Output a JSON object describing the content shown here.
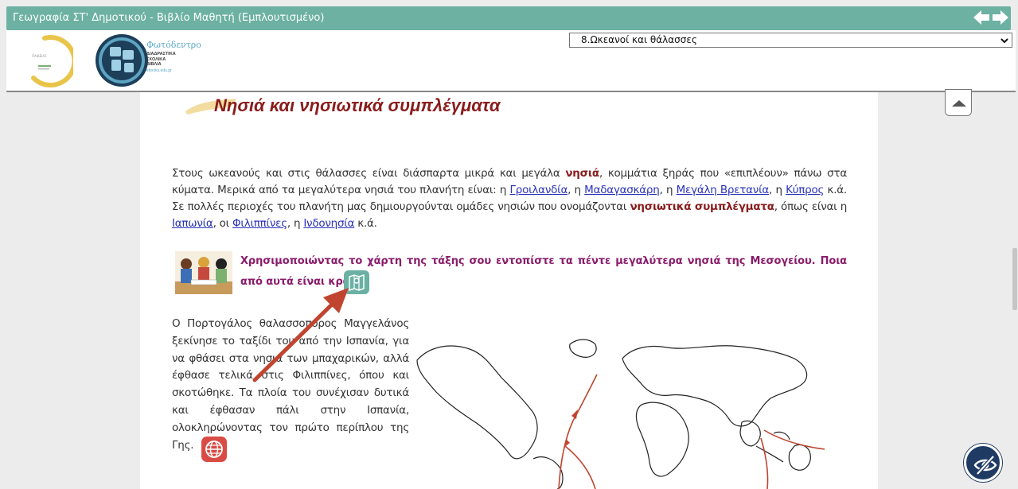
{
  "app": {
    "window_title": "Γεωγραφία ΣΤ' Δημοτικού - Βιβλίο Μαθητή (Εμπλουτισμένο)",
    "chapter_select_value": "8.Ωκεανοί και θάλασσες"
  },
  "logo": {
    "brand": "Φωτόδεντρο",
    "line1": "ΔΙΑΔΡΑΣΤΙΚΑ",
    "line2": "ΣΧΟΛΙΚΑ",
    "line3": "ΒΙΒΛΙΑ",
    "site": "ebooks.edu.gr"
  },
  "lesson": {
    "heading": "Νησιά και νησιωτικά συμπλέγματα",
    "p1_a": "Στους ωκεανούς και στις θάλασσες είναι διάσπαρτα μικρά και μεγάλα ",
    "p1_kw1": "νησιά",
    "p1_b": ", κομμάτια ξηράς που «επιπλέουν» πάνω στα κύματα. Μερικά από τα μεγαλύτερα νησιά του πλανήτη είναι: η ",
    "link_greenland": "Γροιλανδία",
    "sep1": ", η ",
    "link_madagascar": "Μαδαγασκάρη",
    "sep2": ", η ",
    "link_britain": "Μεγάλη Βρετανία",
    "sep3": ", η ",
    "link_cyprus": "Κύπρος",
    "p1_c": " κ.ά. Σε πολλές περιοχές του πλανήτη μας δημιουργούνται ομάδες νησιών που ονομάζονται ",
    "p1_kw2": "νησιωτικά συμπλέγματα",
    "p1_d": ", όπως είναι η ",
    "link_japan": "Ιαπωνία",
    "sep4": ", οι ",
    "link_philippines": "Φιλιππίνες",
    "sep5": ", η ",
    "link_indonesia": "Ινδονησία",
    "p1_e": " κ.ά.",
    "task": "Χρησιμοποιώντας το χάρτη της τάξης σου εντοπίστε τα πέντε μεγαλύτερα νησιά της Μεσογείου. Ποια από αυτά είναι κράτη;",
    "story": "Ο Πορτογάλος θαλασσοπόρος Μαγγελάνος ξεκίνησε το ταξίδι του από την Ισπανία, για να φθάσει στα νησιά των μπαχαρικών, αλλά έφθασε τελικά στις Φιλιππίνες, όπου και σκοτώθηκε. Τα πλοία του συνέχισαν δυτικά και έφθασαν πάλι στην Ισπανία, ολοκληρώνοντας τον πρώτο περίπλου της Γης."
  },
  "icons": {
    "nav_back": "arrow-left-icon",
    "nav_forward": "arrow-right-icon",
    "map": "map-pin-icon",
    "globe": "globe-icon",
    "scroll_top": "chevron-up-icon",
    "accessibility": "eye-slash-icon"
  },
  "colors": {
    "titlebar": "#6cb1a2",
    "heading": "#8a1c1c",
    "task": "#8a1c6b",
    "link": "#2a33b8",
    "arrow": "#c0442f"
  }
}
